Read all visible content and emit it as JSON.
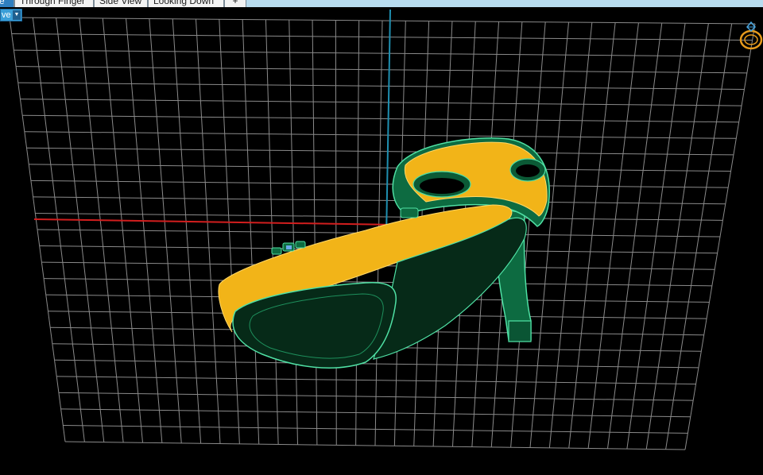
{
  "tabs": [
    {
      "label": "Perspective",
      "active": true
    },
    {
      "label": "Through Finger",
      "active": false
    },
    {
      "label": "Side View",
      "active": false
    },
    {
      "label": "Looking Down",
      "active": false
    },
    {
      "label": "+",
      "active": false
    }
  ],
  "view_select": {
    "value": "ve",
    "icon": "chevron-down-icon"
  },
  "scene": {
    "background": "#000000",
    "grid_color": "#9a9a9a",
    "x_axis_color": "#d21e1e",
    "y_axis_color": "#1f8fb0",
    "model": "high-heel shoe",
    "model_body_color": "#0d6b41",
    "model_sole_color": "#062a18",
    "model_lining_color": "#f2b418",
    "model_highlight_color": "#4fe0a4"
  },
  "ring_icon": {
    "name": "ring-icon",
    "color": "#e69a1c"
  }
}
